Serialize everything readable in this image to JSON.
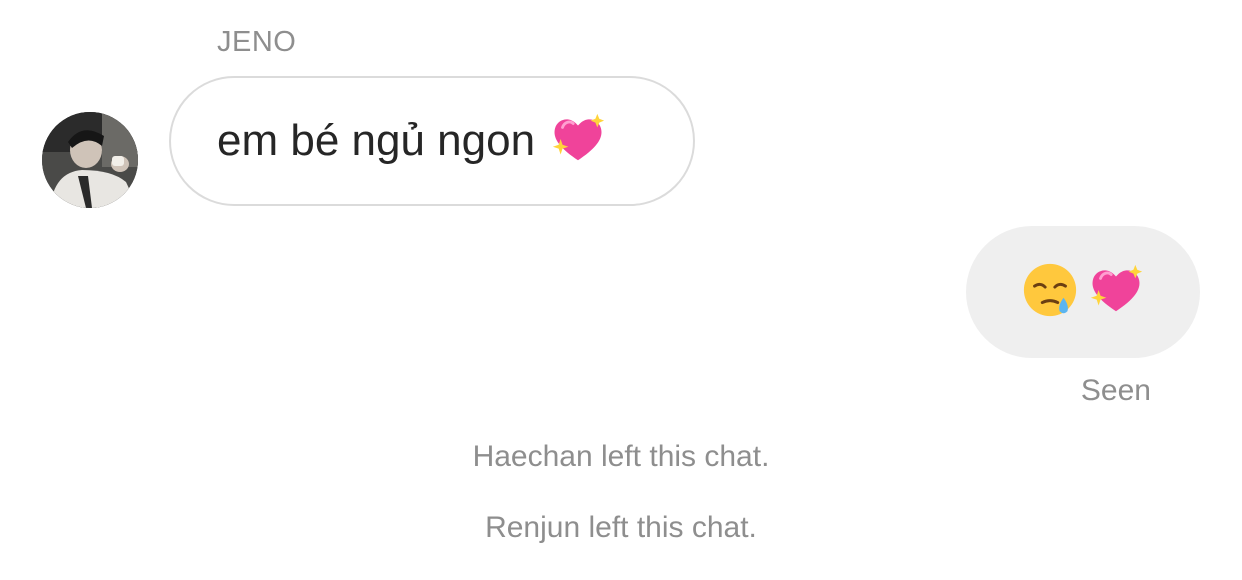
{
  "thread": {
    "incoming": {
      "sender_name": "JENO",
      "text": "em bé ngủ ngon",
      "emoji": "sparkling-heart-icon"
    },
    "outgoing": {
      "emojis": [
        "sleepy-face-icon",
        "sparkling-heart-icon"
      ],
      "status": "Seen"
    },
    "system_messages": [
      "Haechan left this chat.",
      "Renjun left this chat."
    ]
  },
  "colors": {
    "meta_text": "#8e8e8e",
    "incoming_border": "#dbdbdb",
    "outgoing_bg": "#efefef",
    "message_text": "#262626",
    "heart": "#f0439a"
  }
}
